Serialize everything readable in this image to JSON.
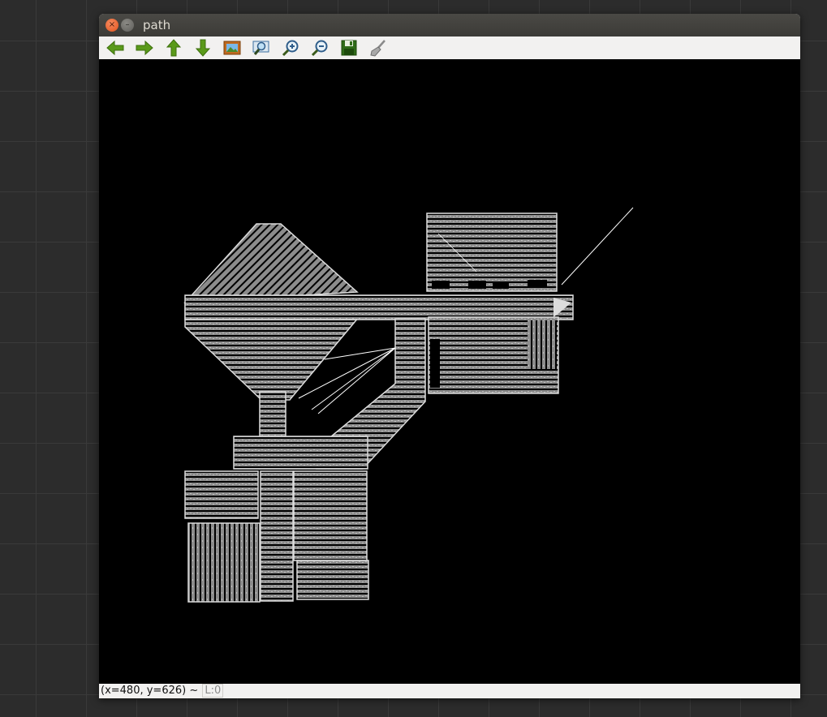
{
  "window": {
    "title": "path"
  },
  "controls": {
    "close_icon": "×",
    "minimize_icon": "–"
  },
  "toolbar": {
    "buttons": [
      {
        "name": "pan-left",
        "icon": "arrow-left-icon"
      },
      {
        "name": "pan-right",
        "icon": "arrow-right-icon"
      },
      {
        "name": "pan-up",
        "icon": "arrow-up-icon"
      },
      {
        "name": "pan-down",
        "icon": "arrow-down-icon"
      },
      {
        "name": "zoom-original",
        "icon": "image-icon"
      },
      {
        "name": "zoom-fit",
        "icon": "zoom-select-icon"
      },
      {
        "name": "zoom-in",
        "icon": "zoom-in-icon"
      },
      {
        "name": "zoom-out",
        "icon": "zoom-out-icon"
      },
      {
        "name": "save-image",
        "icon": "save-icon"
      },
      {
        "name": "properties",
        "icon": "brush-icon"
      }
    ],
    "colors": {
      "arrow": "#5a9a1a",
      "save": "#2f6b18",
      "brush": "#888888"
    }
  },
  "canvas": {
    "background": "#000000",
    "path_color": "#8c8c8c",
    "line_color": "#ffffff"
  },
  "status": {
    "coords": "(x=480, y=626) ~",
    "level": "L:0"
  }
}
